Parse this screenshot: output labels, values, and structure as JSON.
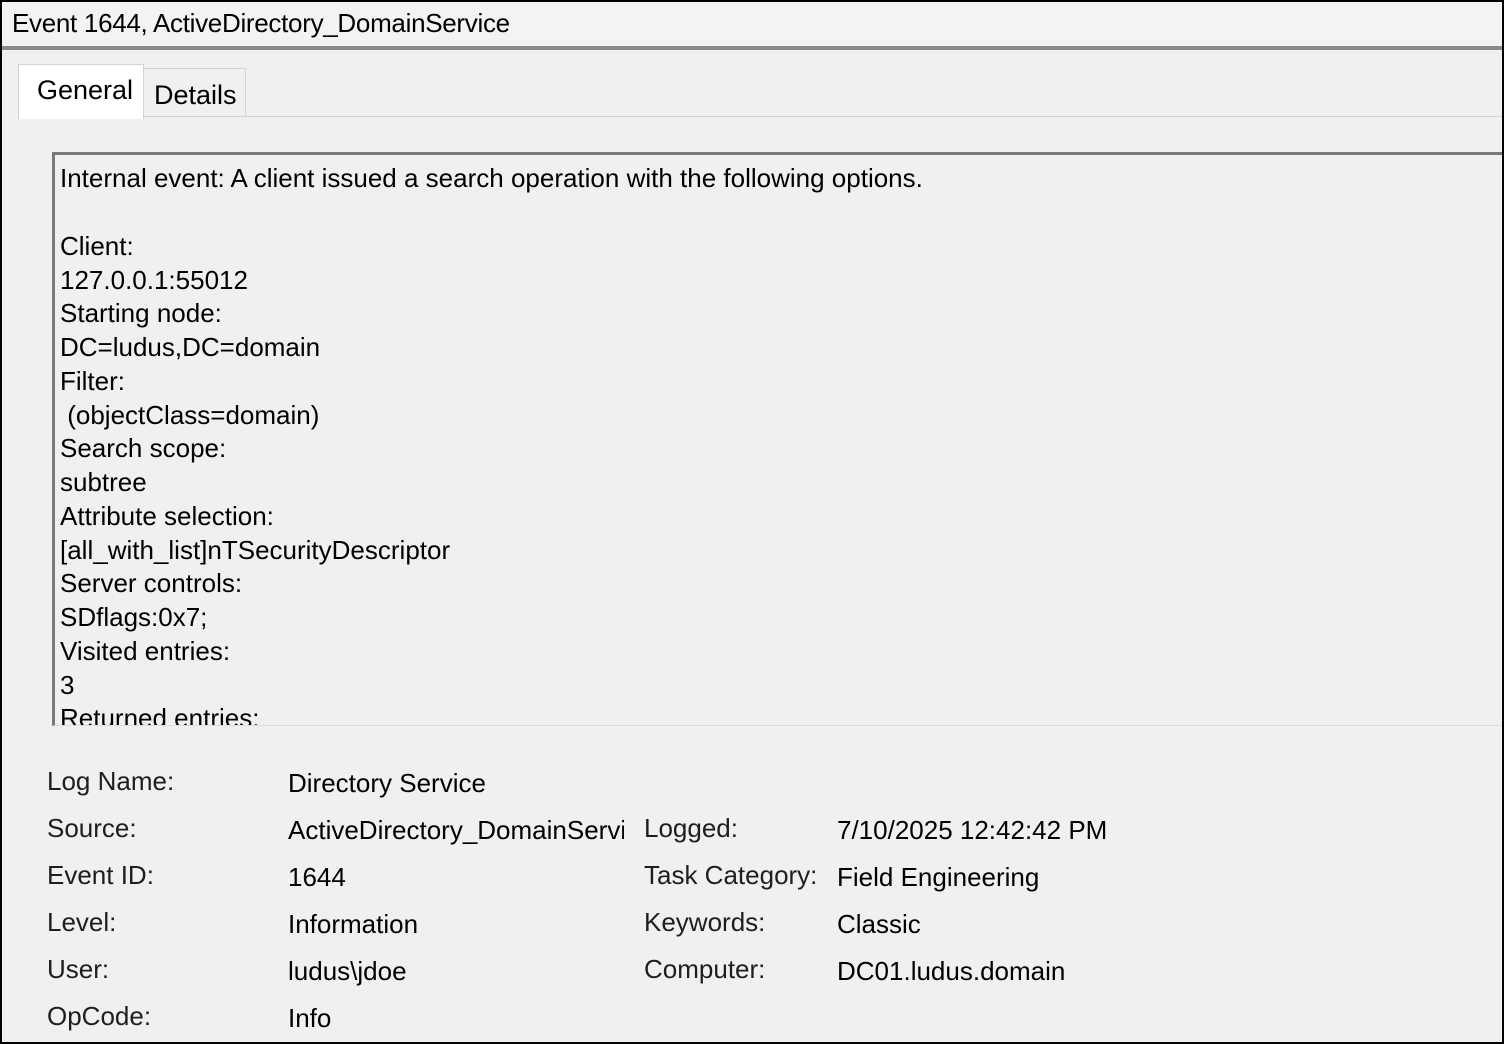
{
  "window": {
    "title": "Event 1644, ActiveDirectory_DomainService"
  },
  "tabs": [
    {
      "label": "General",
      "active": true
    },
    {
      "label": "Details",
      "active": false
    }
  ],
  "description_lines": [
    "Internal event: A client issued a search operation with the following options.",
    "",
    "Client:",
    "127.0.0.1:55012",
    "Starting node:",
    "DC=ludus,DC=domain",
    "Filter:",
    " (objectClass=domain)",
    "Search scope:",
    "subtree",
    "Attribute selection:",
    "[all_with_list]nTSecurityDescriptor",
    "Server controls:",
    "SDflags:0x7;",
    "Visited entries:",
    "3",
    "Returned entries:"
  ],
  "properties": {
    "log_name": {
      "label": "Log Name:",
      "value": "Directory Service"
    },
    "source": {
      "label": "Source:",
      "value": "ActiveDirectory_DomainService"
    },
    "event_id": {
      "label": "Event ID:",
      "value": "1644"
    },
    "level": {
      "label": "Level:",
      "value": "Information"
    },
    "user": {
      "label": "User:",
      "value": "ludus\\jdoe"
    },
    "opcode": {
      "label": "OpCode:",
      "value": "Info"
    },
    "logged": {
      "label": "Logged:",
      "value": "7/10/2025 12:42:42 PM"
    },
    "task_category": {
      "label": "Task Category:",
      "value": "Field Engineering"
    },
    "keywords": {
      "label": "Keywords:",
      "value": "Classic"
    },
    "computer": {
      "label": "Computer:",
      "value": "DC01.ludus.domain"
    }
  }
}
